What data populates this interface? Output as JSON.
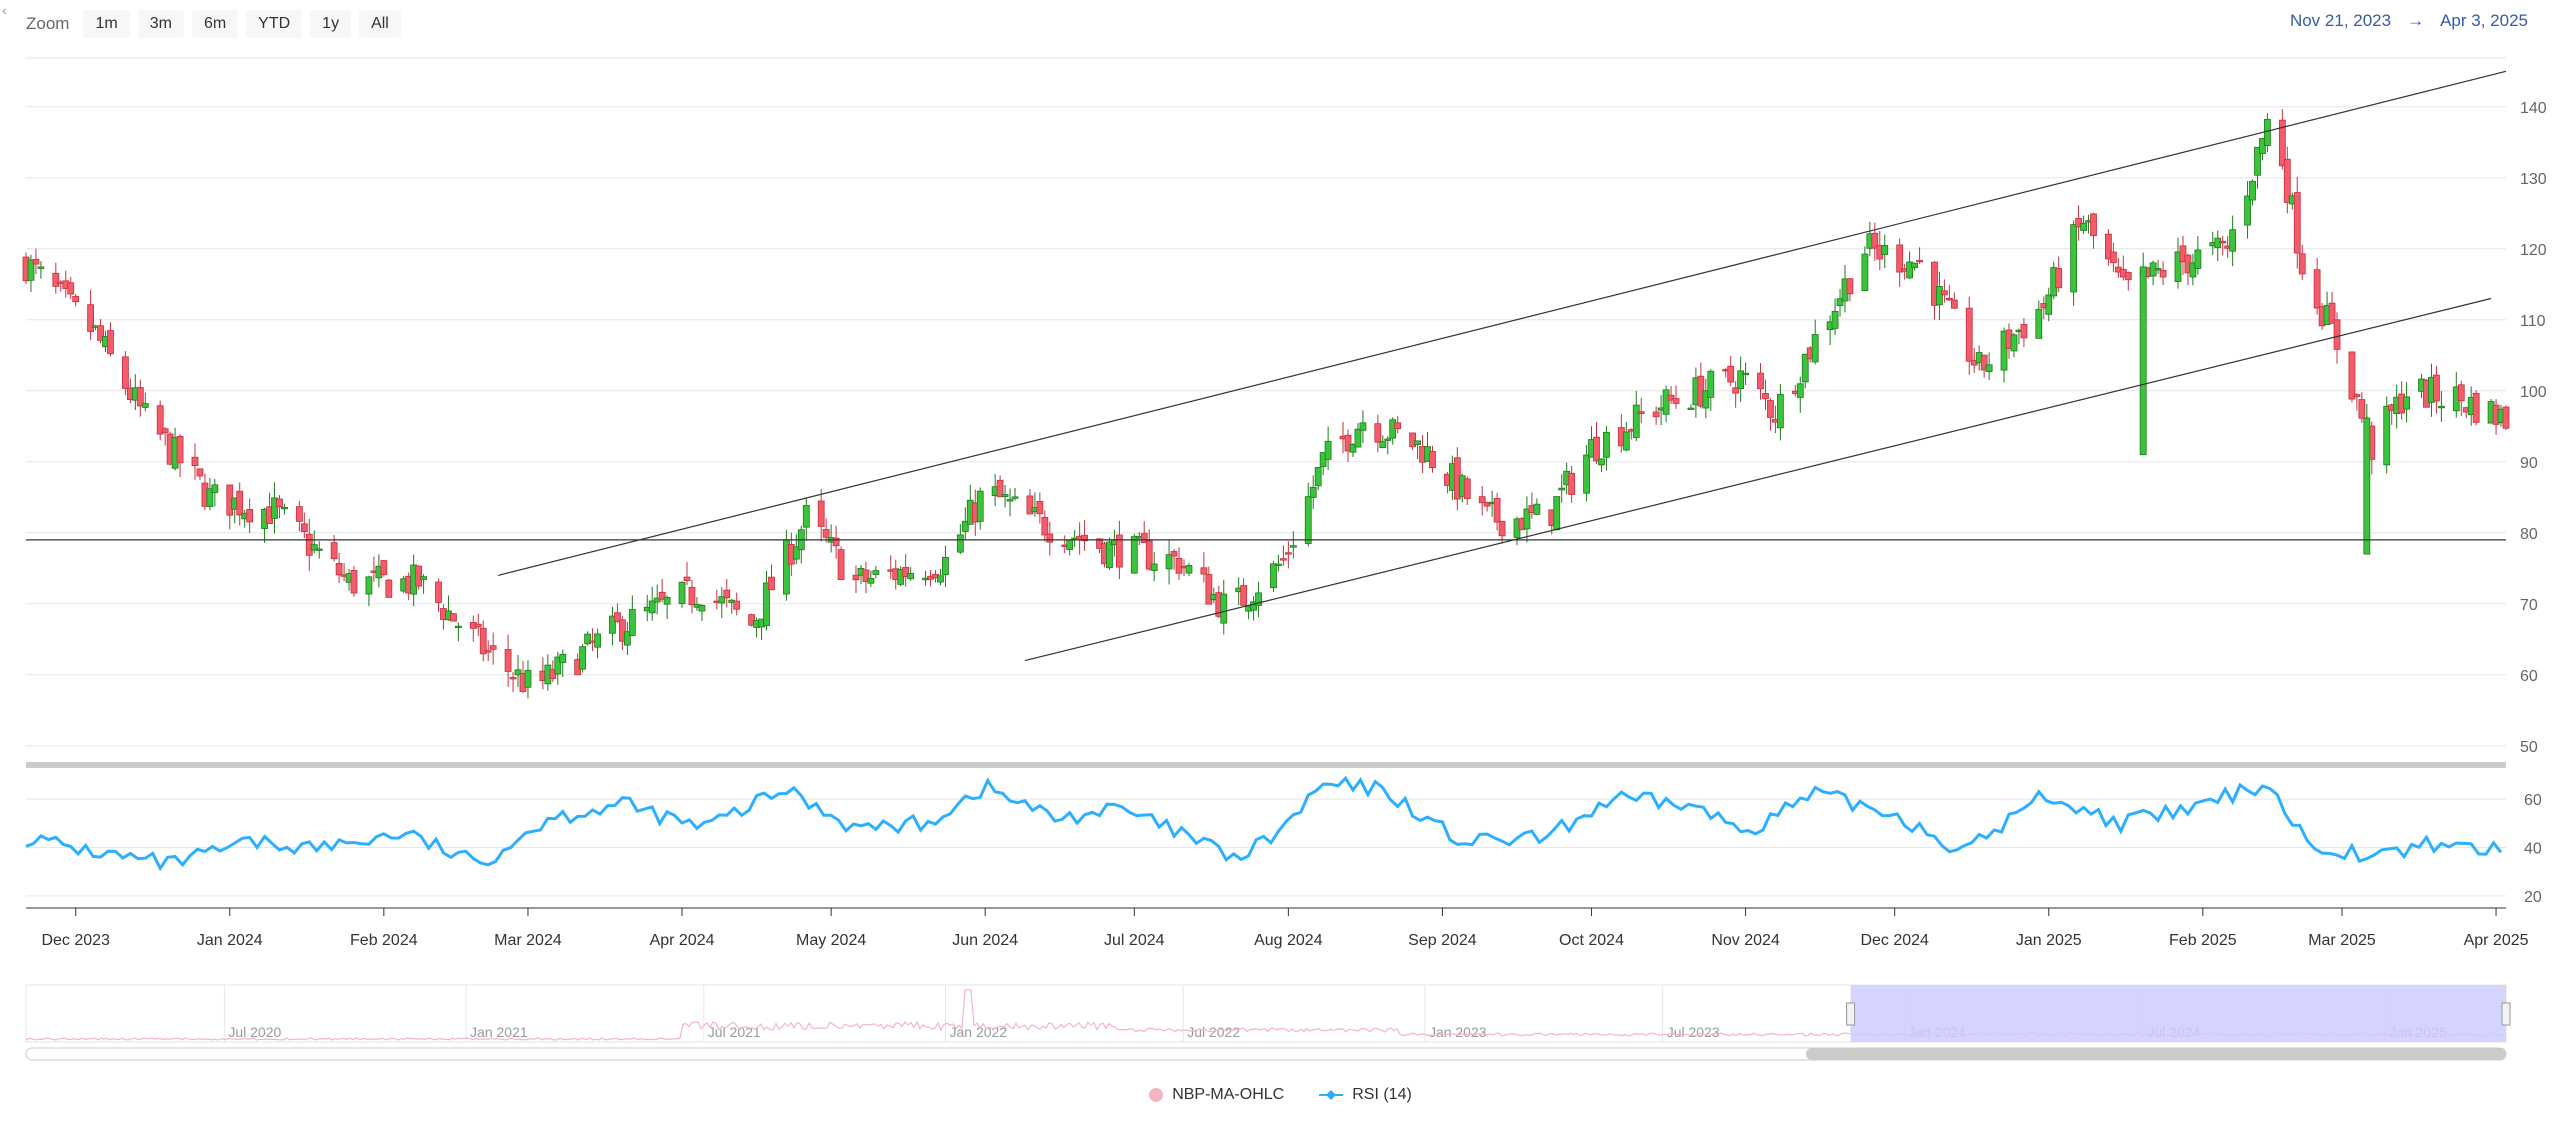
{
  "zoom": {
    "label": "Zoom",
    "buttons": [
      "1m",
      "3m",
      "6m",
      "YTD",
      "1y",
      "All"
    ]
  },
  "range": {
    "from": "Nov 21, 2023",
    "arrow": "→",
    "to": "Apr 3, 2025"
  },
  "legend": [
    {
      "name": "NBP-MA-OHLC",
      "color": "#f4b6c2"
    },
    {
      "name": "RSI (14)",
      "color": "#2caffe"
    }
  ],
  "colors": {
    "up": "#3bc43b",
    "down": "#f25c6b",
    "rsi": "#2caffe",
    "navigator_selection": "#ccccff"
  },
  "chart_data": {
    "type": "candlestick",
    "x_range": [
      "2023-11-21",
      "2025-04-03"
    ],
    "price_axis": {
      "ticks": [
        50,
        60,
        70,
        80,
        90,
        100,
        110,
        120,
        130,
        140
      ],
      "ylim": [
        48,
        148
      ]
    },
    "rsi_axis": {
      "ticks": [
        20,
        40,
        60
      ],
      "ylim": [
        15,
        70
      ]
    },
    "x_ticks": [
      "Dec 2023",
      "Jan 2024",
      "Feb 2024",
      "Mar 2024",
      "Apr 2024",
      "May 2024",
      "Jun 2024",
      "Jul 2024",
      "Aug 2024",
      "Sep 2024",
      "Oct 2024",
      "Nov 2024",
      "Dec 2024",
      "Jan 2025",
      "Feb 2025",
      "Mar 2025",
      "Apr 2025"
    ],
    "x_tick_dates": [
      "2023-12-01",
      "2024-01-01",
      "2024-02-01",
      "2024-03-01",
      "2024-04-01",
      "2024-05-01",
      "2024-06-01",
      "2024-07-01",
      "2024-08-01",
      "2024-09-01",
      "2024-10-01",
      "2024-11-01",
      "2024-12-01",
      "2025-01-01",
      "2025-02-01",
      "2025-03-01",
      "2025-04-01"
    ],
    "price_path": [
      [
        "2023-11-21",
        118
      ],
      [
        "2023-12-05",
        108
      ],
      [
        "2023-12-15",
        96
      ],
      [
        "2023-12-28",
        85
      ],
      [
        "2024-01-10",
        83
      ],
      [
        "2024-01-25",
        73
      ],
      [
        "2024-02-08",
        73
      ],
      [
        "2024-02-22",
        63
      ],
      [
        "2024-03-02",
        58
      ],
      [
        "2024-03-20",
        67
      ],
      [
        "2024-04-05",
        72
      ],
      [
        "2024-04-15",
        67
      ],
      [
        "2024-04-26",
        82
      ],
      [
        "2024-05-06",
        73
      ],
      [
        "2024-05-24",
        76
      ],
      [
        "2024-06-01",
        86
      ],
      [
        "2024-06-10",
        82
      ],
      [
        "2024-06-25",
        78
      ],
      [
        "2024-07-10",
        76
      ],
      [
        "2024-07-20",
        69
      ],
      [
        "2024-07-31",
        76
      ],
      [
        "2024-08-08",
        90
      ],
      [
        "2024-08-16",
        96
      ],
      [
        "2024-08-28",
        92
      ],
      [
        "2024-09-10",
        82
      ],
      [
        "2024-09-22",
        82
      ],
      [
        "2024-10-01",
        92
      ],
      [
        "2024-10-15",
        98
      ],
      [
        "2024-10-31",
        102
      ],
      [
        "2024-11-07",
        97
      ],
      [
        "2024-11-25",
        120
      ],
      [
        "2024-12-06",
        118
      ],
      [
        "2024-12-18",
        103
      ],
      [
        "2024-12-31",
        112
      ],
      [
        "2025-01-08",
        124
      ],
      [
        "2025-01-16",
        114
      ],
      [
        "2025-01-27",
        118
      ],
      [
        "2025-02-06",
        120
      ],
      [
        "2025-02-15",
        140
      ],
      [
        "2025-02-21",
        118
      ],
      [
        "2025-03-01",
        105
      ],
      [
        "2025-03-07",
        92
      ],
      [
        "2025-03-14",
        100
      ],
      [
        "2025-03-24",
        99
      ],
      [
        "2025-04-03",
        96
      ]
    ],
    "dip_candles": [
      {
        "date": "2025-03-06",
        "low": 77
      },
      {
        "date": "2025-01-20",
        "low": 91
      }
    ],
    "rsi_path": [
      [
        "2023-11-21",
        44
      ],
      [
        "2023-12-05",
        38
      ],
      [
        "2023-12-20",
        33
      ],
      [
        "2024-01-05",
        42
      ],
      [
        "2024-01-20",
        40
      ],
      [
        "2024-02-05",
        46
      ],
      [
        "2024-02-20",
        33
      ],
      [
        "2024-03-05",
        52
      ],
      [
        "2024-03-20",
        58
      ],
      [
        "2024-04-05",
        48
      ],
      [
        "2024-04-22",
        64
      ],
      [
        "2024-05-06",
        48
      ],
      [
        "2024-05-20",
        50
      ],
      [
        "2024-06-01",
        65
      ],
      [
        "2024-06-15",
        52
      ],
      [
        "2024-06-28",
        56
      ],
      [
        "2024-07-10",
        46
      ],
      [
        "2024-07-22",
        35
      ],
      [
        "2024-07-31",
        48
      ],
      [
        "2024-08-08",
        66
      ],
      [
        "2024-08-20",
        64
      ],
      [
        "2024-09-05",
        42
      ],
      [
        "2024-09-22",
        44
      ],
      [
        "2024-10-05",
        60
      ],
      [
        "2024-10-20",
        58
      ],
      [
        "2024-11-01",
        47
      ],
      [
        "2024-11-15",
        62
      ],
      [
        "2024-12-01",
        54
      ],
      [
        "2024-12-15",
        38
      ],
      [
        "2024-12-31",
        62
      ],
      [
        "2025-01-15",
        50
      ],
      [
        "2025-01-30",
        56
      ],
      [
        "2025-02-14",
        67
      ],
      [
        "2025-02-22",
        42
      ],
      [
        "2025-03-08",
        36
      ],
      [
        "2025-03-20",
        42
      ],
      [
        "2025-04-03",
        38
      ]
    ],
    "annotations": [
      {
        "type": "trendline",
        "from": [
          "2024-02-24",
          74
        ],
        "to": [
          "2025-04-03",
          145
        ]
      },
      {
        "type": "trendline",
        "from": [
          "2024-06-09",
          62
        ],
        "to": [
          "2025-03-31",
          113
        ]
      },
      {
        "type": "horizontal",
        "value": 79
      }
    ],
    "navigator": {
      "labels": [
        "Jul 2020",
        "Jan 2021",
        "Jul 2021",
        "Jan 2022",
        "Jul 2022",
        "Jan 2023",
        "Jul 2023",
        "Jan 2024",
        "Jul 2024",
        "Jan 2025"
      ],
      "selected_from": "2023-11-21",
      "selected_to": "2025-04-03"
    }
  }
}
